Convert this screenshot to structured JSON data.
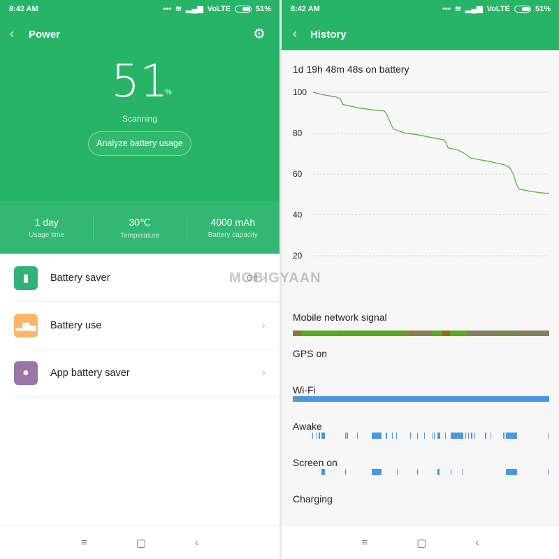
{
  "status_bar": {
    "time": "8:42 AM",
    "network": "VoLTE",
    "battery": "51%"
  },
  "power": {
    "title": "Power",
    "level": "51",
    "level_unit": "%",
    "state": "Scanning",
    "analyze_button": "Analyze battery usage",
    "stats": [
      {
        "value": "1 day",
        "label": "Usage time"
      },
      {
        "value": "30℃",
        "label": "Temperature"
      },
      {
        "value": "4000 mAh",
        "label": "Battery capacity"
      }
    ],
    "menu": [
      {
        "label": "Battery saver",
        "value": "Off",
        "icon": "battery-bolt-icon",
        "color": "#2fb37a"
      },
      {
        "label": "Battery use",
        "icon": "bar-chart-icon",
        "color": "#fdb56a"
      },
      {
        "label": "App battery saver",
        "icon": "bulb-bolt-icon",
        "color": "#9b74a8"
      }
    ]
  },
  "watermark": "MOBIGYAAN",
  "history": {
    "title": "History",
    "on_battery": "1d 19h 48m 48s on battery",
    "rows": {
      "network": "Mobile network signal",
      "gps": "GPS on",
      "wifi": "Wi-Fi",
      "awake": "Awake",
      "screen": "Screen on",
      "charging": "Charging"
    }
  },
  "chart_data": {
    "type": "line",
    "ylim": [
      0,
      100
    ],
    "yticks": [
      "100",
      "80",
      "60",
      "40",
      "20"
    ],
    "grid": true,
    "line_color": "#4caf30",
    "x_unit": "fraction of time on battery",
    "x": [
      0,
      0.036,
      0.096,
      0.115,
      0.127,
      0.194,
      0.272,
      0.302,
      0.311,
      0.329,
      0.341,
      0.39,
      0.449,
      0.508,
      0.552,
      0.562,
      0.572,
      0.616,
      0.646,
      0.666,
      0.744,
      0.813,
      0.833,
      0.847,
      0.862,
      0.872,
      0.921,
      0.98,
      1.0
    ],
    "y": [
      100,
      98.9,
      97.7,
      96.9,
      94.0,
      92.3,
      91.1,
      90.8,
      89.4,
      84.6,
      82.0,
      80.0,
      79.1,
      77.7,
      76.8,
      75.4,
      72.8,
      71.6,
      69.7,
      67.8,
      66.2,
      64.4,
      63.0,
      60.1,
      54.9,
      52.6,
      51.5,
      50.6,
      50.6
    ]
  },
  "tracks": {
    "network": [
      [
        0,
        0.036,
        "#8a7a3a"
      ],
      [
        0.036,
        0.174,
        "#5aaa22"
      ],
      [
        0.174,
        0.424,
        "#55a624"
      ],
      [
        0.424,
        0.451,
        "#6f9a2a"
      ],
      [
        0.451,
        0.542,
        "#8a7d55"
      ],
      [
        0.542,
        0.583,
        "#5aaa22"
      ],
      [
        0.583,
        0.614,
        "#8a6a20"
      ],
      [
        0.614,
        0.682,
        "#5aaa22"
      ],
      [
        0.682,
        0.823,
        "#857e5e"
      ],
      [
        0.823,
        0.873,
        "#7a8a45"
      ],
      [
        0.873,
        1.0,
        "#857e5e"
      ]
    ],
    "wifi": [
      [
        0,
        0.822,
        "#4a98dd"
      ],
      [
        0.824,
        1.0,
        "#4a98dd"
      ]
    ],
    "awake": [
      [
        0.077,
        0.08
      ],
      [
        0.093,
        0.096
      ],
      [
        0.102,
        0.105
      ],
      [
        0.111,
        0.126
      ],
      [
        0.204,
        0.207
      ],
      [
        0.211,
        0.214
      ],
      [
        0.25,
        0.253
      ],
      [
        0.309,
        0.345
      ],
      [
        0.363,
        0.369
      ],
      [
        0.386,
        0.389
      ],
      [
        0.404,
        0.407
      ],
      [
        0.458,
        0.461
      ],
      [
        0.485,
        0.488
      ],
      [
        0.513,
        0.516
      ],
      [
        0.544,
        0.547
      ],
      [
        0.551,
        0.554
      ],
      [
        0.563,
        0.575
      ],
      [
        0.593,
        0.596
      ],
      [
        0.616,
        0.664
      ],
      [
        0.673,
        0.676
      ],
      [
        0.684,
        0.687
      ],
      [
        0.696,
        0.699
      ],
      [
        0.708,
        0.711
      ],
      [
        0.75,
        0.755
      ],
      [
        0.77,
        0.773
      ],
      [
        0.819,
        0.822
      ],
      [
        0.825,
        0.828
      ],
      [
        0.832,
        0.875
      ],
      [
        0.997,
        1.0
      ]
    ],
    "screen": [
      [
        0.111,
        0.126
      ],
      [
        0.204,
        0.207
      ],
      [
        0.309,
        0.345
      ],
      [
        0.406,
        0.409
      ],
      [
        0.485,
        0.488
      ],
      [
        0.563,
        0.573
      ],
      [
        0.616,
        0.619
      ],
      [
        0.663,
        0.666
      ],
      [
        0.832,
        0.875
      ],
      [
        0.997,
        1.0
      ]
    ],
    "bar_color": "#4a98dd"
  }
}
